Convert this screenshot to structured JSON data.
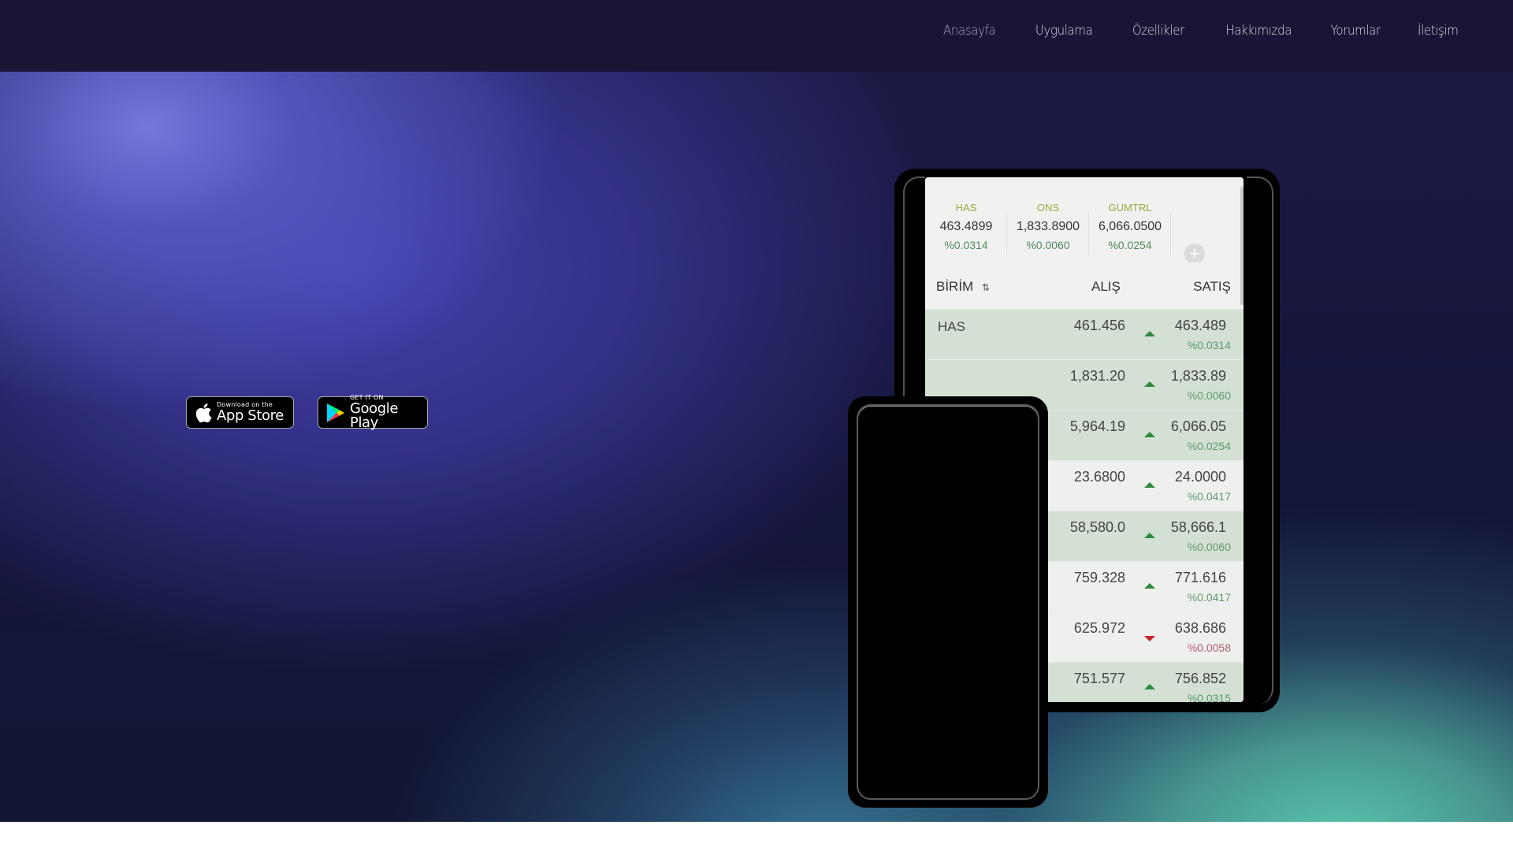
{
  "nav": {
    "items": [
      "Anasayfa",
      "Uygulama",
      "Özellikler",
      "Hakkımızda",
      "Yorumlar",
      "İletişim"
    ]
  },
  "badges": {
    "apple": {
      "small": "Download on the",
      "big": "App Store"
    },
    "google": {
      "small": "GET IT ON",
      "big": "Google Play"
    }
  },
  "app": {
    "ticker": [
      {
        "label": "HAS",
        "value": "463.4899",
        "change": "%0.0314"
      },
      {
        "label": "ONS",
        "value": "1,833.8900",
        "change": "%0.0060"
      },
      {
        "label": "GUMTRL",
        "value": "6,066.0500",
        "change": "%0.0254"
      }
    ],
    "add_icon": "+",
    "columns": {
      "unit": "BİRİM",
      "sort_icon": "⇅",
      "buy": "ALIŞ",
      "sell": "SATIŞ"
    },
    "rows": [
      {
        "unit": "HAS",
        "buy": "461.456",
        "sell": "463.489",
        "change": "%0.0314",
        "direction": "up"
      },
      {
        "unit": "",
        "buy": "1,831.20",
        "sell": "1,833.89",
        "change": "%0.0060",
        "direction": "up"
      },
      {
        "unit": "",
        "buy": "5,964.19",
        "sell": "6,066.05",
        "change": "%0.0254",
        "direction": "up"
      },
      {
        "unit": "",
        "buy": "23.6800",
        "sell": "24.0000",
        "change": "%0.0417",
        "direction": "up"
      },
      {
        "unit": "",
        "buy": "58,580.0",
        "sell": "58,666.1",
        "change": "%0.0060",
        "direction": "up"
      },
      {
        "unit": "",
        "buy": "759.328",
        "sell": "771.616",
        "change": "%0.0417",
        "direction": "up"
      },
      {
        "unit": "",
        "buy": "625.972",
        "sell": "638.686",
        "change": "%0.0058",
        "direction": "down"
      },
      {
        "unit": "",
        "buy": "751.577",
        "sell": "756.852",
        "change": "%0.0315",
        "direction": "up"
      }
    ],
    "row_shading": [
      "up",
      "up",
      "up",
      "plain",
      "up",
      "plain",
      "plain",
      "up"
    ]
  },
  "colors": {
    "header_bg": "#181634",
    "up": "#2f8a3e",
    "down": "#c0262d",
    "ticker_label": "#9aa83d"
  }
}
